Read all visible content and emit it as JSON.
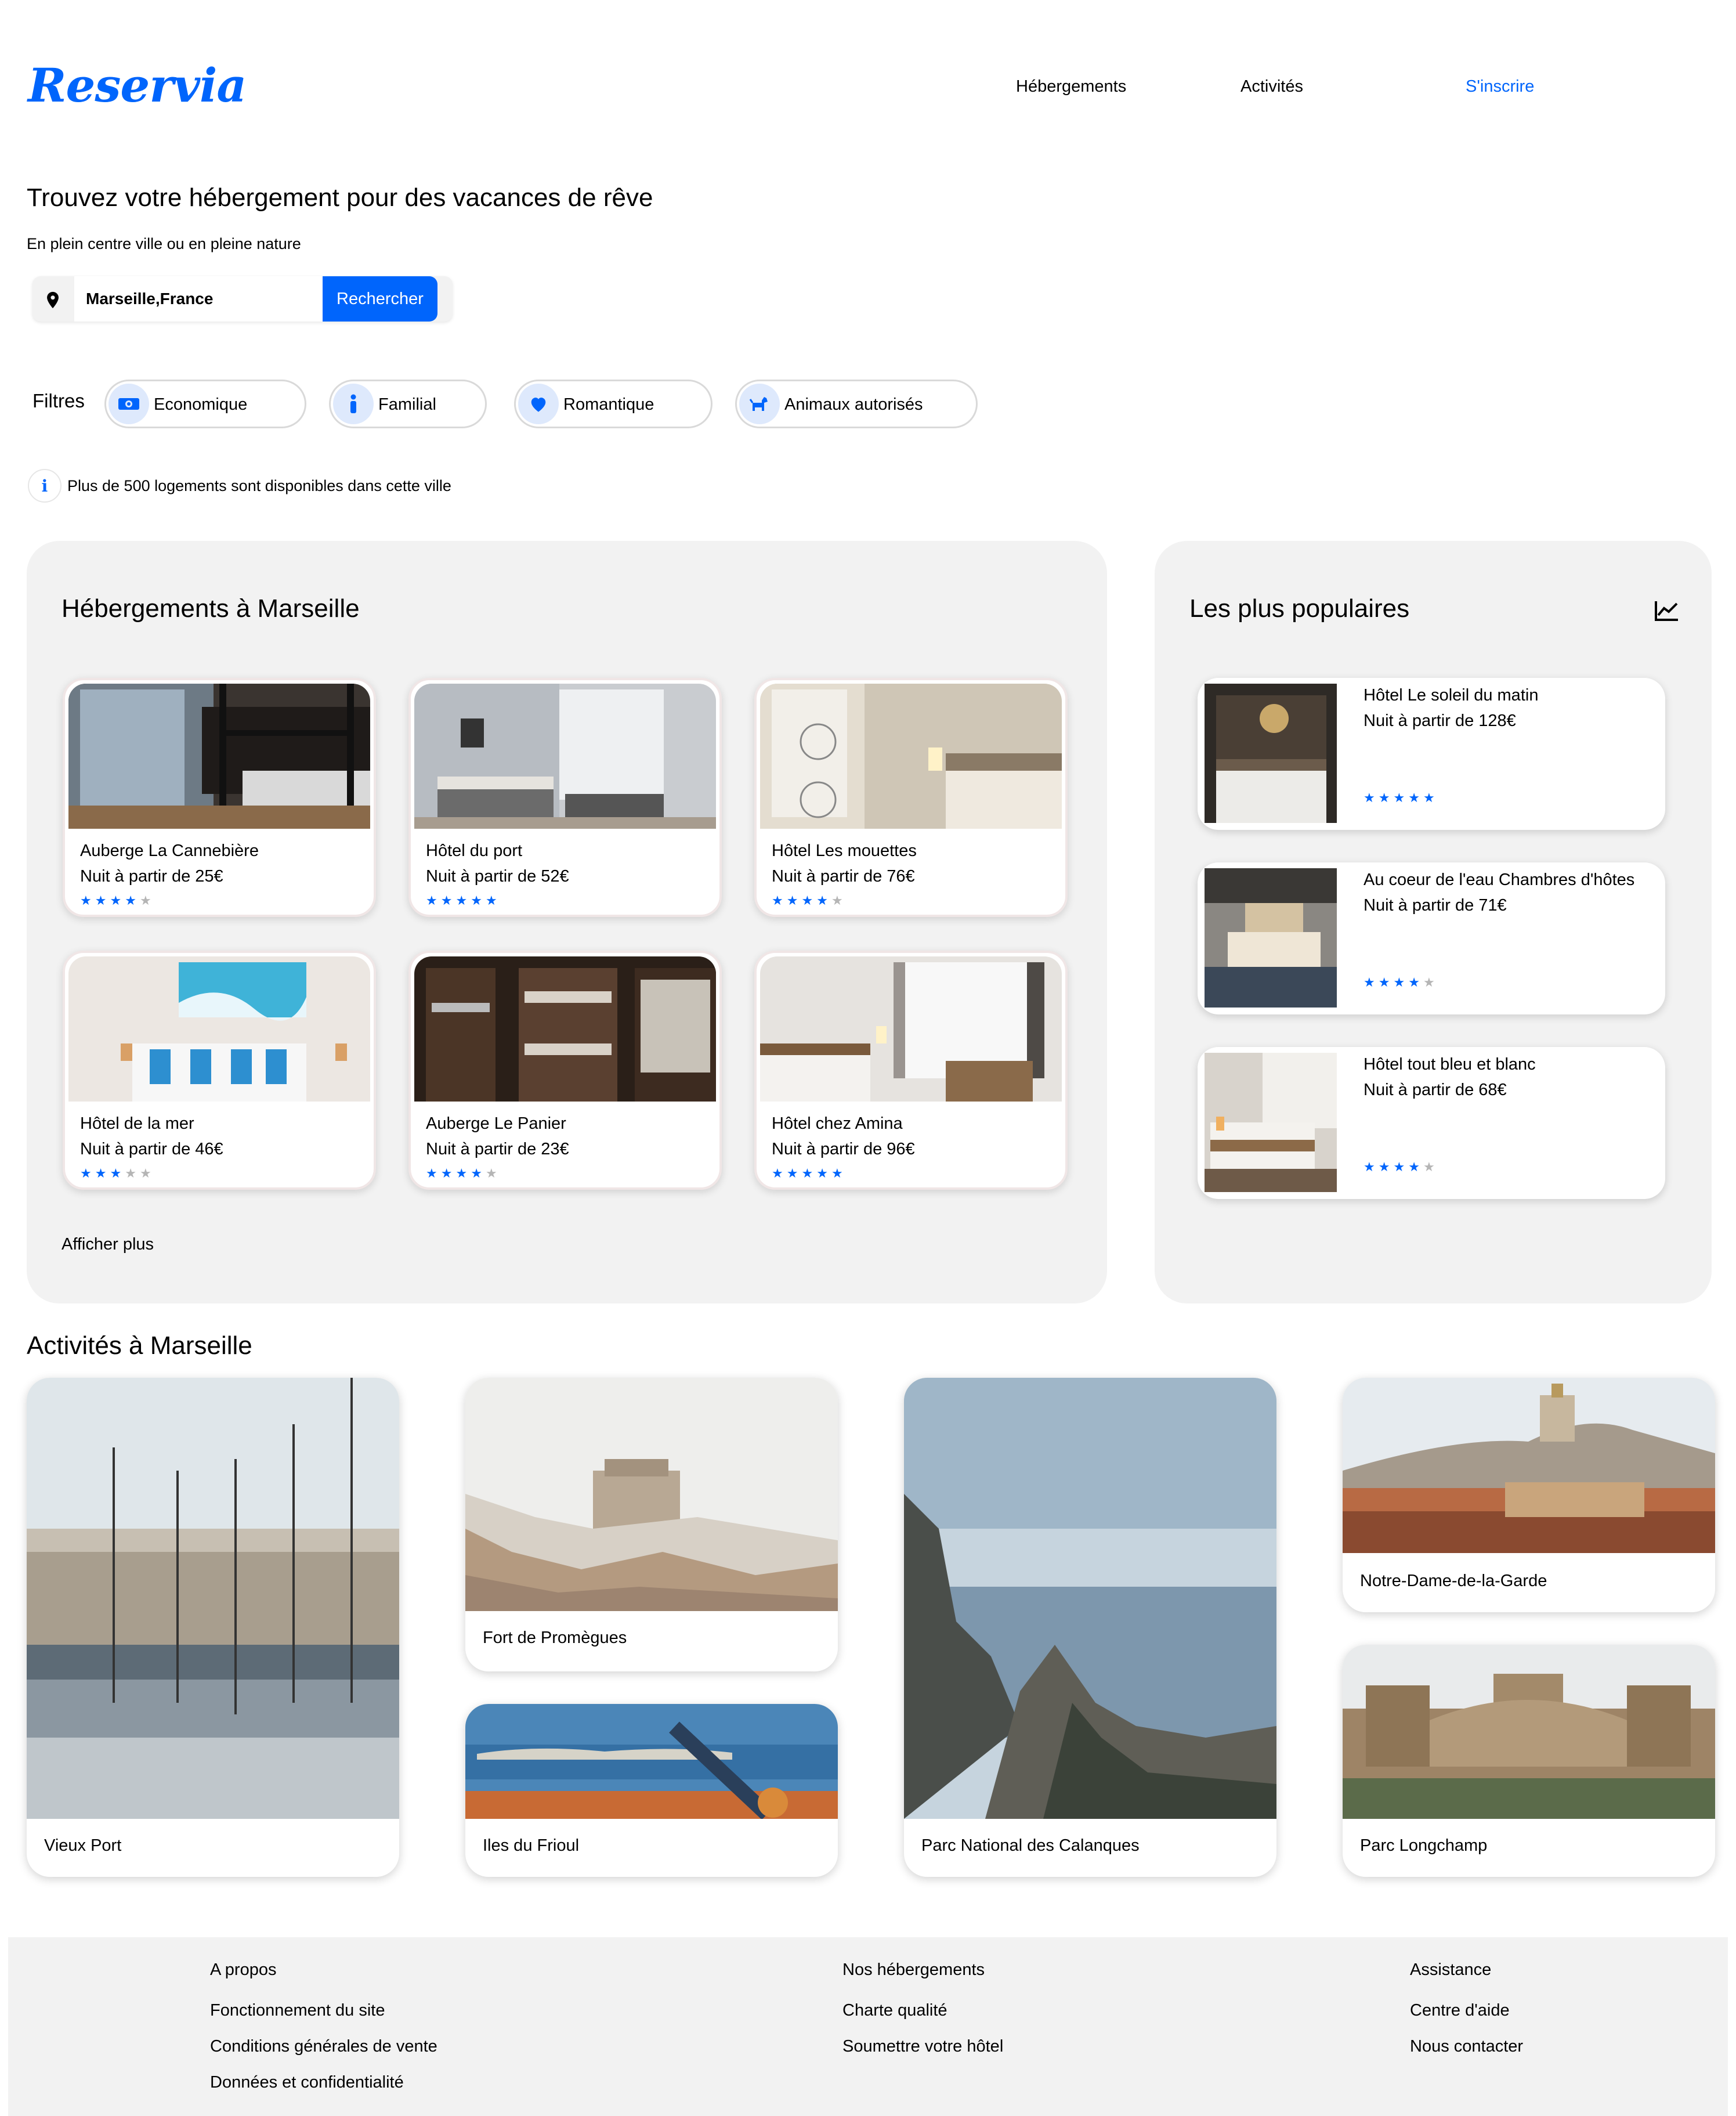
{
  "brand": {
    "name": "Reservia",
    "color": "#0065fc"
  },
  "nav": {
    "items": [
      {
        "label": "Hébergements"
      },
      {
        "label": "Activités"
      }
    ],
    "signup": "S'inscrire"
  },
  "hero": {
    "title": "Trouvez votre hébergement pour des vacances de rêve",
    "subtitle": "En plein centre ville ou en pleine nature",
    "search_value": "Marseille,France",
    "search_button": "Rechercher",
    "location_icon": "map-pin-icon"
  },
  "filters": {
    "label": "Filtres",
    "items": [
      {
        "label": "Economique",
        "icon": "money-icon"
      },
      {
        "label": "Familial",
        "icon": "person-icon"
      },
      {
        "label": "Romantique",
        "icon": "heart-icon"
      },
      {
        "label": "Animaux autorisés",
        "icon": "dog-icon"
      }
    ]
  },
  "info": {
    "text": "Plus de 500 logements sont disponibles dans cette ville",
    "icon": "info-icon"
  },
  "accommodations": {
    "title": "Hébergements à Marseille",
    "more": "Afficher plus",
    "items": [
      {
        "name": "Auberge La Cannebière",
        "price": "Nuit à partir de 25€",
        "rating": 4
      },
      {
        "name": "Hôtel du port",
        "price": "Nuit à partir de 52€",
        "rating": 5
      },
      {
        "name": "Hôtel Les mouettes",
        "price": "Nuit à partir de 76€",
        "rating": 4
      },
      {
        "name": "Hôtel de la mer",
        "price": "Nuit à partir de 46€",
        "rating": 3
      },
      {
        "name": "Auberge Le Panier",
        "price": "Nuit à partir de 23€",
        "rating": 4
      },
      {
        "name": "Hôtel chez Amina",
        "price": "Nuit à partir de 96€",
        "rating": 5
      }
    ]
  },
  "popular": {
    "title": "Les plus populaires",
    "icon": "trending-chart-icon",
    "items": [
      {
        "name": "Hôtel Le soleil du matin",
        "price": "Nuit à partir de 128€",
        "rating": 5
      },
      {
        "name": "Au coeur de l'eau Chambres d'hôtes",
        "price": "Nuit à partir de 71€",
        "rating": 4
      },
      {
        "name": "Hôtel tout bleu et blanc",
        "price": "Nuit à partir de 68€",
        "rating": 4
      }
    ]
  },
  "activities": {
    "title": "Activités à Marseille",
    "items": [
      {
        "name": "Vieux Port"
      },
      {
        "name": "Fort de Promègues"
      },
      {
        "name": "Iles du Frioul"
      },
      {
        "name": "Parc National des Calanques"
      },
      {
        "name": "Notre-Dame-de-la-Garde"
      },
      {
        "name": "Parc Longchamp"
      }
    ]
  },
  "footer": {
    "columns": [
      {
        "title": "A propos",
        "links": [
          "Fonctionnement du site",
          "Conditions générales de vente",
          "Données et confidentialité"
        ]
      },
      {
        "title": "Nos hébergements",
        "links": [
          "Charte qualité",
          "Soumettre votre hôtel"
        ]
      },
      {
        "title": "Assistance",
        "links": [
          "Centre d'aide",
          "Nous contacter"
        ]
      }
    ]
  },
  "colors": {
    "accent": "#0065fc",
    "panel_bg": "#f2f2f2",
    "star_off": "#b5b5b5",
    "filter_icon_bg": "#dee9fc"
  }
}
